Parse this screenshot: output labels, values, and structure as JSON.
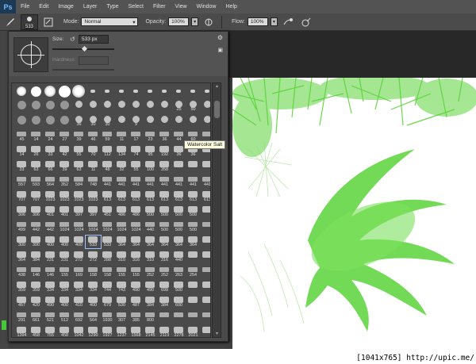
{
  "app": {
    "logo": "Ps"
  },
  "menu": [
    "File",
    "Edit",
    "Image",
    "Layer",
    "Type",
    "Select",
    "Filter",
    "View",
    "Window",
    "Help"
  ],
  "options": {
    "brush_size": "533",
    "mode_label": "Mode:",
    "mode_value": "Normal",
    "opacity_label": "Opacity:",
    "opacity_value": "100%",
    "flow_label": "Flow:",
    "flow_value": "100%"
  },
  "brush_panel": {
    "size_label": "Size:",
    "size_value": "533 px",
    "size_fraction": 0.49,
    "hardness_label": "Hardness:",
    "tooltip": "Watercolor Salt",
    "scroll_position": 0.05,
    "rows": [
      [
        "",
        "",
        "",
        "",
        "",
        "",
        "",
        "",
        "",
        "",
        "",
        "",
        "",
        ""
      ],
      [
        "",
        "",
        "",
        "",
        "",
        "",
        "",
        "",
        "",
        "",
        "",
        "25",
        "50",
        ""
      ],
      [
        "",
        "",
        "",
        "",
        "36",
        "30",
        "30",
        "",
        "9",
        "",
        "",
        "",
        "",
        ""
      ],
      [
        "45",
        "14",
        "24",
        "27",
        "39",
        "46",
        "59",
        "11",
        "17",
        "23",
        "36",
        "44",
        "60",
        ""
      ],
      [
        "14",
        "26",
        "33",
        "42",
        "55",
        "70",
        "112",
        "134",
        "74",
        "95",
        "192",
        "36",
        "36",
        ""
      ],
      [
        "33",
        "63",
        "66",
        "39",
        "63",
        "11",
        "48",
        "32",
        "55",
        "100",
        "358",
        "",
        "",
        ""
      ],
      [
        "557",
        "593",
        "564",
        "352",
        "584",
        "748",
        "441",
        "441",
        "441",
        "441",
        "441",
        "441",
        "441",
        "441"
      ],
      [
        "707",
        "707",
        "1023",
        "1023",
        "1023",
        "1023",
        "613",
        "613",
        "613",
        "613",
        "613",
        "613",
        "613",
        "613"
      ],
      [
        "306",
        "306",
        "401",
        "401",
        "397",
        "397",
        "451",
        "486",
        "486",
        "500",
        "500",
        "500",
        "500",
        ""
      ],
      [
        "499",
        "442",
        "442",
        "1024",
        "1024",
        "1024",
        "1024",
        "1024",
        "1024",
        "440",
        "500",
        "500",
        "500",
        ""
      ],
      [
        "300",
        "300",
        "400",
        "400",
        "400",
        "533",
        "533",
        "364",
        "364",
        "364",
        "364",
        "364",
        "364",
        ""
      ],
      [
        "364",
        "384",
        "231",
        "231",
        "272",
        "272",
        "288",
        "310",
        "316",
        "310",
        "316",
        "440",
        "",
        ""
      ],
      [
        "438",
        "146",
        "146",
        "155",
        "169",
        "158",
        "158",
        "155",
        "155",
        "252",
        "252",
        "263",
        "254",
        ""
      ],
      [
        "359",
        "359",
        "334",
        "334",
        "334",
        "334",
        "744",
        "743",
        "490",
        "490",
        "699",
        "500",
        "",
        ""
      ],
      [
        "457",
        "420",
        "490",
        "400",
        "410",
        "400",
        "679",
        "530",
        "487",
        "384",
        "384",
        "600",
        "",
        ""
      ],
      [
        "291",
        "661",
        "521",
        "512",
        "692",
        "564",
        "1930",
        "307",
        "385",
        "800",
        "",
        "",
        "",
        ""
      ],
      [
        "1394",
        "458",
        "755",
        "458",
        "1042",
        "1290",
        "1927",
        "1237",
        "1568",
        "2145",
        "2119",
        "2278",
        "2021",
        ""
      ]
    ]
  },
  "footer": {
    "stamp": "[1041x765] http://upic.me/"
  }
}
